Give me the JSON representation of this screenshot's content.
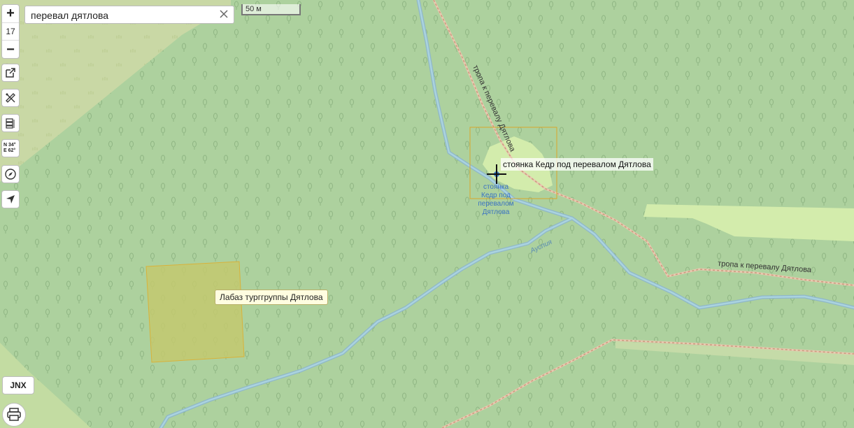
{
  "search": {
    "value": "перевал дятлова"
  },
  "zoom": {
    "in_label": "+",
    "level": "17",
    "out_label": "−"
  },
  "scale": {
    "label": "50 м"
  },
  "toolbar": {
    "icons": [
      "open-external-icon",
      "ruler-icon",
      "layers-icon",
      "coordinates-icon",
      "compass-icon",
      "locate-icon"
    ],
    "coords_text": [
      "N 34°",
      "E 62°"
    ]
  },
  "map": {
    "trail_label_1": "тропа к перевалу Дятлова",
    "trail_label_2": "тропа к перевалу Дятлова",
    "stream_label": "Ауспия",
    "poi_label": "стоянка Кедр под перевалом Дятлова",
    "poi_caption": [
      "стоянка",
      "Кедр под",
      "перевалом",
      "Дятлова"
    ],
    "tooltip": "Лабаз турггруппы Дятлова",
    "colors": {
      "forest": "#add19e",
      "meadow": "#cdeba5",
      "water": "#aad3df",
      "highlight": "#d9c24a"
    }
  },
  "bottom": {
    "jnx_label": "JNX"
  }
}
